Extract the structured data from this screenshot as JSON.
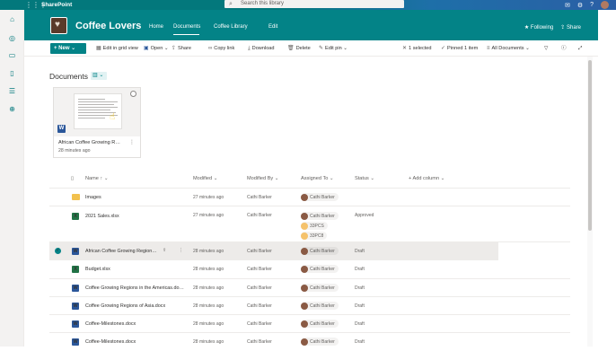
{
  "suite": {
    "brand": "SharePoint",
    "search_placeholder": "Search this library",
    "waffle_icon": "waffle-icon",
    "icons": [
      "chat-icon",
      "settings-icon",
      "help-icon"
    ]
  },
  "rail": [
    "home-icon",
    "sites-icon",
    "news-icon",
    "files-icon",
    "lists-icon",
    "create-icon"
  ],
  "site": {
    "title": "Coffee Lovers",
    "nav": [
      {
        "label": "Home",
        "active": false
      },
      {
        "label": "Documents",
        "active": true
      },
      {
        "label": "Coffee Library",
        "active": false
      },
      {
        "label": "Edit",
        "active": false
      }
    ],
    "following": "Following",
    "share": "Share"
  },
  "commandbar": {
    "new_label": "New",
    "items": [
      "Edit in grid view",
      "Open",
      "Share",
      "Copy link",
      "Download",
      "Delete",
      "Edit pin"
    ],
    "selected": "1 selected",
    "pinned": "Pinned 1 item",
    "all_docs": "All Documents"
  },
  "library": {
    "title": "Documents",
    "pinned_card": {
      "name": "African Coffee Growing R…",
      "time": "28 minutes ago"
    }
  },
  "columns": {
    "name": "Name",
    "modified": "Modified",
    "modified_by": "Modified By",
    "assigned_to": "Assigned To",
    "status": "Status",
    "add_column": "+ Add column"
  },
  "rows": [
    {
      "type": "folder",
      "name": "Images",
      "modified": "27 minutes ago",
      "modified_by": "Cathi Barker",
      "assigned": [
        "Cathi Barker"
      ],
      "status": ""
    },
    {
      "type": "excel",
      "name": "2021 Sales.xlsx",
      "modified": "27 minutes ago",
      "modified_by": "Cathi Barker",
      "assigned": [
        "Cathi Barker",
        "33PCS",
        "33PC8"
      ],
      "status": "Approved"
    },
    {
      "type": "word",
      "name": "African Coffee Growing Region…",
      "modified": "28 minutes ago",
      "modified_by": "Cathi Barker",
      "assigned": [
        "Cathi Barker"
      ],
      "status": "Draft",
      "selected": true
    },
    {
      "type": "excel",
      "name": "Budget.xlsx",
      "modified": "28 minutes ago",
      "modified_by": "Cathi Barker",
      "assigned": [
        "Cathi Barker"
      ],
      "status": "Draft"
    },
    {
      "type": "word",
      "name": "Coffee Growing Regions in the Americas.do…",
      "modified": "28 minutes ago",
      "modified_by": "Cathi Barker",
      "assigned": [
        "Cathi Barker"
      ],
      "status": "Draft"
    },
    {
      "type": "word",
      "name": "Coffee Growing Regions of Asia.docx",
      "modified": "28 minutes ago",
      "modified_by": "Cathi Barker",
      "assigned": [
        "Cathi Barker"
      ],
      "status": "Draft"
    },
    {
      "type": "word",
      "name": "Coffee-Milestones.docx",
      "modified": "28 minutes ago",
      "modified_by": "Cathi Barker",
      "assigned": [
        "Cathi Barker"
      ],
      "status": "Draft"
    },
    {
      "type": "word",
      "name": "Coffee-Milestones.docx",
      "modified": "28 minutes ago",
      "modified_by": "Cathi Barker",
      "assigned": [
        "Cathi Barker"
      ],
      "status": "Draft"
    }
  ]
}
